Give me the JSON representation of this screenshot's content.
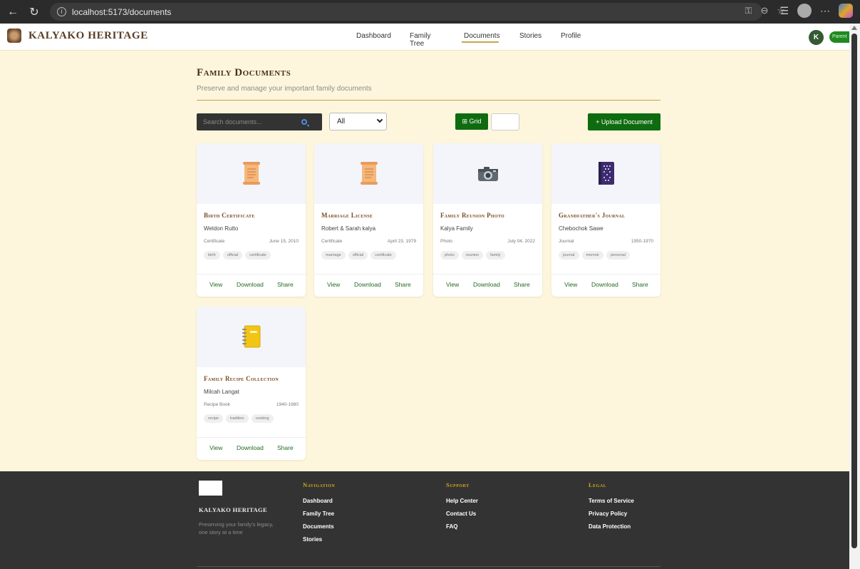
{
  "browser": {
    "url": "localhost:5173/documents",
    "back_icon": "arrow-left-icon",
    "reload_icon": "reload-icon"
  },
  "header": {
    "brand_name": "KALYAKO HERITAGE",
    "nav": [
      {
        "label": "Dashboard"
      },
      {
        "label": "Family Tree"
      },
      {
        "label": "Documents",
        "active": true
      },
      {
        "label": "Stories"
      },
      {
        "label": "Profile"
      }
    ],
    "avatar_initial": "K",
    "role_badge": "Parent",
    "accent_color": "#c9a64a"
  },
  "page": {
    "title": "Family Documents",
    "subtitle": "Preserve and manage your important family documents"
  },
  "controls": {
    "search_placeholder": "Search documents...",
    "filter_selected": "All",
    "grid_label": "⊞ Grid",
    "upload_label": "+ Upload Document",
    "button_color": "#0f6b0f"
  },
  "documents": [
    {
      "title": "Birth Certificate",
      "owner": "Weldon Rutto",
      "type": "Certificate",
      "date": "June 15, 2010",
      "tags": [
        "birth",
        "official",
        "certificate"
      ],
      "icon": "scroll-icon"
    },
    {
      "title": "Marriage License",
      "owner": "Robert & Sarah kalya",
      "type": "Certificate",
      "date": "April 23, 1979",
      "tags": [
        "marriage",
        "official",
        "certificate"
      ],
      "icon": "scroll-icon"
    },
    {
      "title": "Family Reunion Photo",
      "owner": "Kalya Family",
      "type": "Photo",
      "date": "July 04, 2022",
      "tags": [
        "photo",
        "reunion",
        "family"
      ],
      "icon": "camera-icon"
    },
    {
      "title": "Grandfather's Journal",
      "owner": "Chebochok Sawe",
      "type": "Journal",
      "date": "1950-1970",
      "tags": [
        "journal",
        "memoir",
        "personal"
      ],
      "icon": "notebook-icon"
    },
    {
      "title": "Family Recipe Collection",
      "owner": "Milcah Langat",
      "type": "Recipe Book",
      "date": "1940-1980",
      "tags": [
        "recipe",
        "tradition",
        "cooking"
      ],
      "icon": "ledger-icon"
    }
  ],
  "card_actions": {
    "view": "View",
    "download": "Download",
    "share": "Share"
  },
  "footer": {
    "brand": "KALYAKO HERITAGE",
    "tagline": "Preserving your family's legacy, one story at a time",
    "columns": [
      {
        "heading": "Navigation",
        "links": [
          "Dashboard",
          "Family Tree",
          "Documents",
          "Stories"
        ]
      },
      {
        "heading": "Support",
        "links": [
          "Help Center",
          "Contact Us",
          "FAQ"
        ]
      },
      {
        "heading": "Legal",
        "links": [
          "Terms of Service",
          "Privacy Policy",
          "Data Protection"
        ]
      }
    ]
  }
}
